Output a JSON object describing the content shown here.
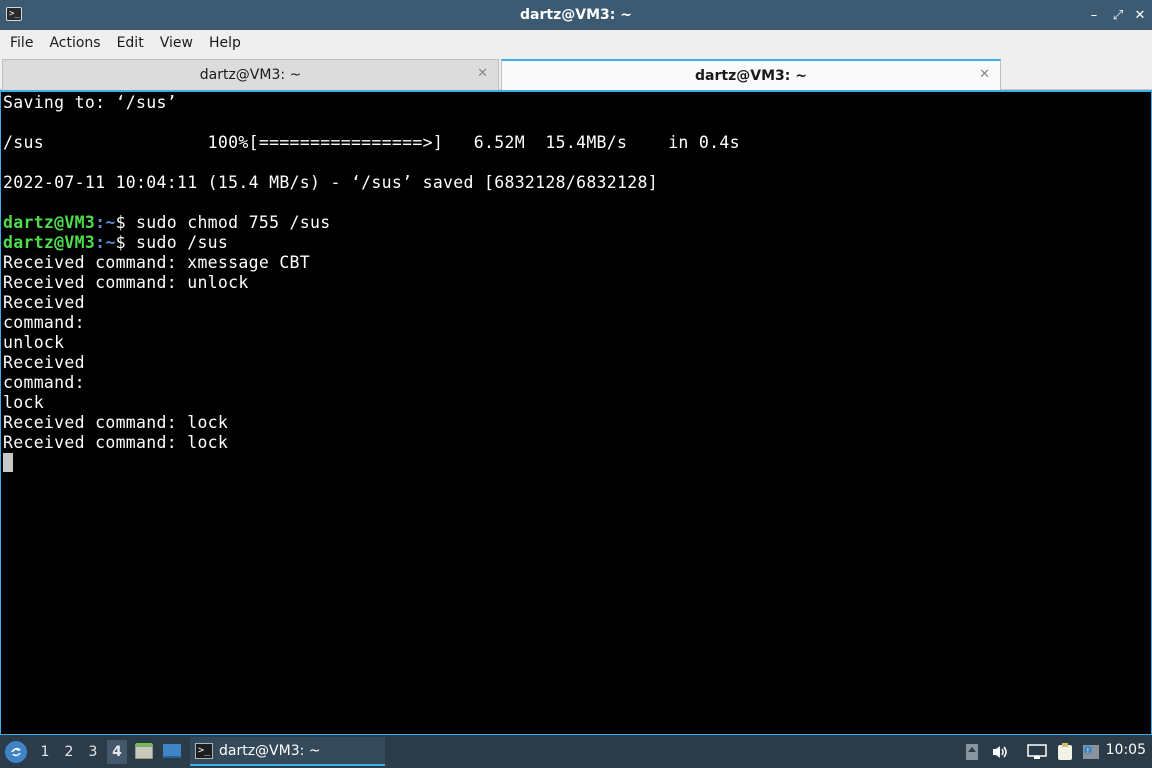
{
  "window": {
    "title": "dartz@VM3: ~",
    "minimize_glyph": "–",
    "restore_glyph": "⤢",
    "close_glyph": "✕"
  },
  "menu": [
    "File",
    "Actions",
    "Edit",
    "View",
    "Help"
  ],
  "tabs": [
    {
      "label": "dartz@VM3: ~",
      "active": false,
      "close": "✕"
    },
    {
      "label": "dartz@VM3: ~",
      "active": true,
      "close": "✕"
    }
  ],
  "terminal": {
    "lines": [
      "Saving to: ‘/sus’",
      "",
      "/sus                100%[================>]   6.52M  15.4MB/s    in 0.4s",
      "",
      "2022-07-11 10:04:11 (15.4 MB/s) - ‘/sus’ saved [6832128/6832128]",
      ""
    ],
    "prompt_user": "dartz@VM3",
    "prompt_sep": ":",
    "prompt_path": "~",
    "prompt_dollar": "$ ",
    "commands": [
      "sudo chmod 755 /sus",
      "sudo /sus"
    ],
    "output": [
      "Received command: xmessage CBT",
      "Received command: unlock",
      "Received",
      "command:",
      "unlock",
      "Received",
      "command:",
      "lock",
      "Received command: lock",
      "Received command: lock"
    ]
  },
  "taskbar": {
    "desktops": [
      "1",
      "2",
      "3",
      "4"
    ],
    "current_desktop": "4",
    "task_label": "dartz@VM3: ~",
    "clock": "10:05"
  },
  "icons": {
    "start": "lxqt-start-icon",
    "file_manager": "file-manager-icon",
    "show_desktop": "show-desktop-icon",
    "terminal": "terminal-icon",
    "tray": [
      "tray-expand-icon",
      "volume-icon",
      "network-icon",
      "clipboard-icon",
      "notification-icon"
    ]
  },
  "colors": {
    "titlebar": "#3c5a72",
    "accent": "#3daee9",
    "prompt_user": "#4edc4e",
    "prompt_path": "#5c8dd6",
    "taskbar": "#2b3b48"
  }
}
